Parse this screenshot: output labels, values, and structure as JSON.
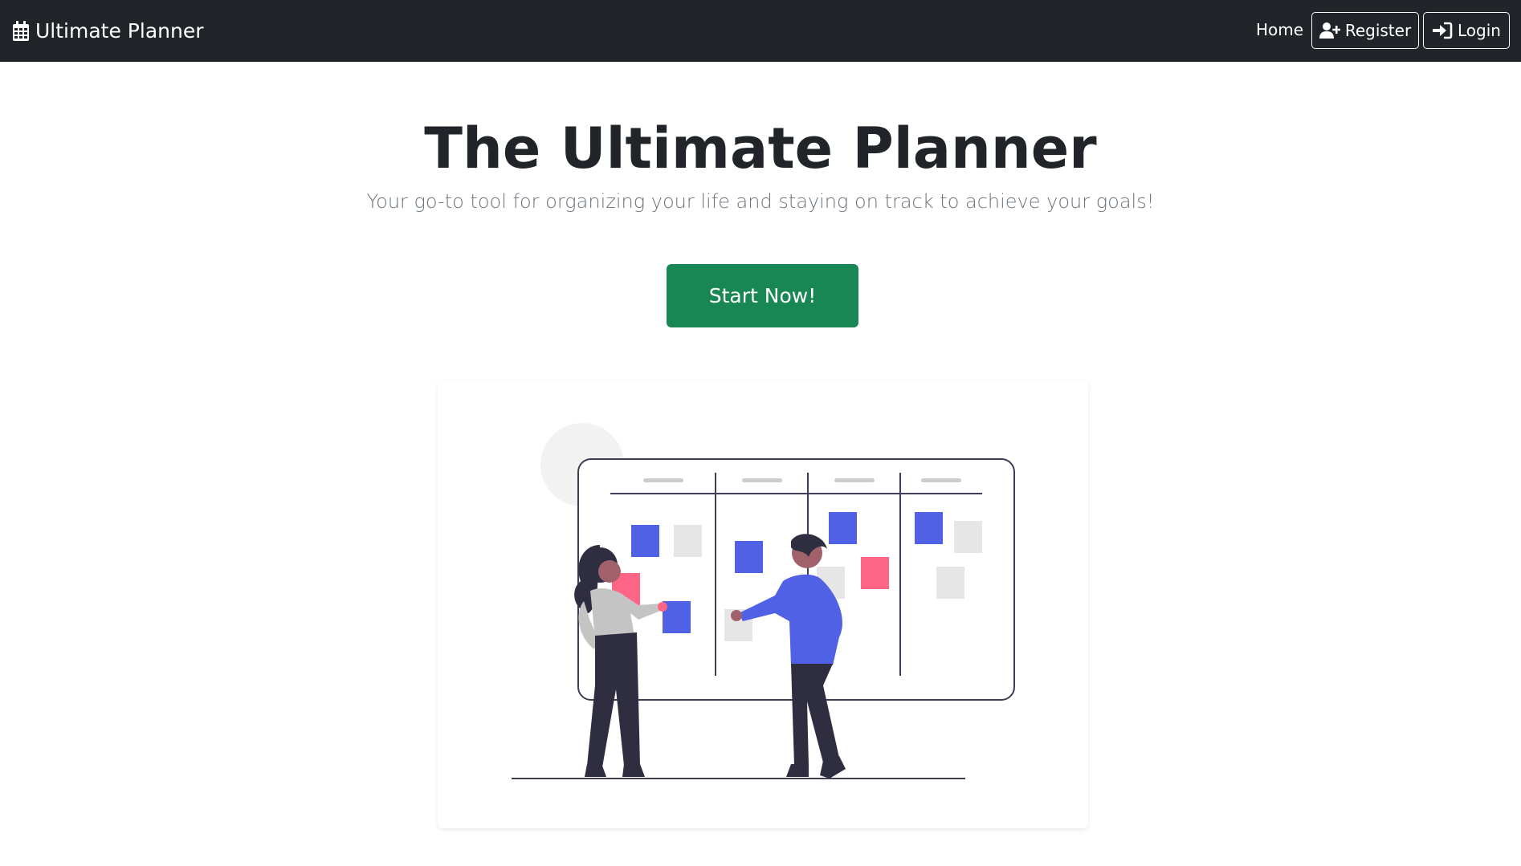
{
  "navbar": {
    "brand_icon": "calendar-icon",
    "brand": "Ultimate Planner",
    "home_label": "Home",
    "register_icon": "user-plus-icon",
    "register_label": "Register",
    "login_icon": "sign-in-icon",
    "login_label": "Login"
  },
  "hero": {
    "title": "The Ultimate Planner",
    "subtitle": "Your go-to tool for organizing your life and staying on track to achieve your goals!",
    "cta_label": "Start Now!"
  },
  "illustration": {
    "description_icon": "kanban-board-illustration",
    "colors": {
      "blue": "#5161e6",
      "pink": "#ff6584",
      "gray": "#e6e6e6",
      "dark": "#2f2e41",
      "line": "#3f3d56"
    }
  },
  "colors": {
    "navbar_bg": "#212529",
    "success": "#198754",
    "muted": "#6c757d"
  }
}
